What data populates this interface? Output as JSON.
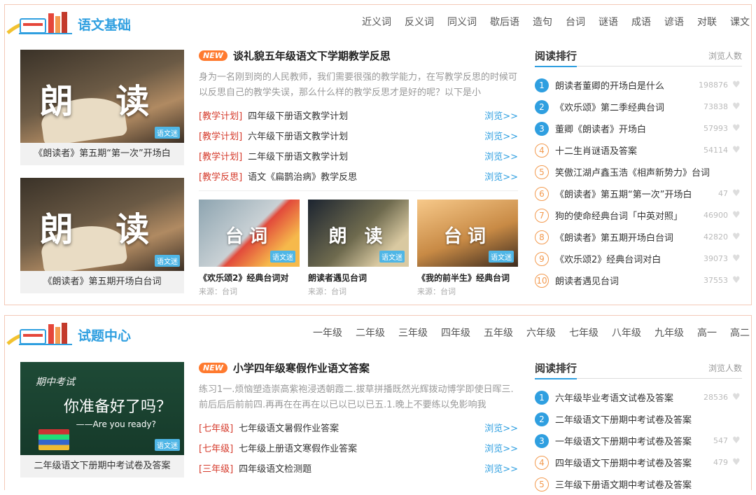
{
  "colors": {
    "accent": "#2f9fe0",
    "category": "#d53a2b",
    "badge": "#ff7a2f",
    "rank_low": "#f39a4f",
    "border": "#f3c9b8"
  },
  "sections": [
    {
      "title": "语文基础",
      "nav": [
        "近义词",
        "反义词",
        "同义词",
        "歇后语",
        "造句",
        "台词",
        "谜语",
        "成语",
        "谚语",
        "对联",
        "课文"
      ],
      "thumbs": [
        {
          "overlay": "朗 读",
          "watermark": "语文迷",
          "caption": "《朗读者》第五期“第一次”开场白"
        },
        {
          "overlay": "朗 读",
          "watermark": "语文迷",
          "caption": "《朗读者》第五期开场白台词"
        }
      ],
      "badge": "NEW",
      "headline": "谈礼貌五年级语文下学期教学反思",
      "summary": "身为一名刚到岗的人民教师，我们需要很强的教学能力，在写教学反思的时候可以反思自己的教学失误，那么什么样的教学反思才是好的呢？以下是小",
      "articles": [
        {
          "cat": "[教学计划]",
          "title": "四年级下册语文教学计划",
          "more": "浏览>>"
        },
        {
          "cat": "[教学计划]",
          "title": "六年级下册语文教学计划",
          "more": "浏览>>"
        },
        {
          "cat": "[教学计划]",
          "title": "二年级下册语文教学计划",
          "more": "浏览>>"
        },
        {
          "cat": "[教学反思]",
          "title": "语文《扁鹊治病》教学反思",
          "more": "浏览>>"
        }
      ],
      "cards": [
        {
          "overlay": "台词",
          "title": "《欢乐颂2》经典台词对",
          "source": "来源：台词"
        },
        {
          "overlay": "朗 读",
          "title": "朗读者遇见台词",
          "source": "来源：台词"
        },
        {
          "overlay": "台词",
          "title": "《我的前半生》经典台词",
          "source": "来源：台词"
        }
      ],
      "rank_title": "阅读排行",
      "rank_sub": "浏览人数",
      "ranks": [
        {
          "n": "1",
          "title": "朗读者董卿的开场白是什么",
          "count": "198876"
        },
        {
          "n": "2",
          "title": "《欢乐颂》第二季经典台词",
          "count": "73838"
        },
        {
          "n": "3",
          "title": "董卿《朗读者》开场白",
          "count": "57993"
        },
        {
          "n": "4",
          "title": "十二生肖谜语及答案",
          "count": "54114"
        },
        {
          "n": "5",
          "title": "笑傲江湖卢鑫玉浩《相声新势力》台词",
          "count": ""
        },
        {
          "n": "6",
          "title": "《朗读者》第五期“第一次”开场白",
          "count": "47"
        },
        {
          "n": "7",
          "title": "狗的使命经典台词「中英对照」",
          "count": "46900"
        },
        {
          "n": "8",
          "title": "《朗读者》第五期开场白台词",
          "count": "42820"
        },
        {
          "n": "9",
          "title": "《欢乐颂2》经典台词对白",
          "count": "39073"
        },
        {
          "n": "10",
          "title": "朗读者遇见台词",
          "count": "37553"
        }
      ]
    },
    {
      "title": "试题中心",
      "nav": [
        "一年级",
        "二年级",
        "三年级",
        "四年级",
        "五年级",
        "六年级",
        "七年级",
        "八年级",
        "九年级",
        "高一",
        "高二"
      ],
      "thumbs": [
        {
          "exam_line1": "期中考试",
          "exam_line2": "你准备好了吗？",
          "exam_line3": "——Are you ready?",
          "watermark": "语文迷",
          "caption": "二年级语文下册期中考试卷及答案"
        }
      ],
      "badge": "NEW",
      "headline": "小学四年级寒假作业语文答案",
      "summary": "练习1一.烦恼塑造崇高紫袍浸透朝霞二.拔草拼播既然光辉拨动博学即使日晖三.前后后后前前四.再再在在再在以已以已以已五.1.晚上不要练以免影响我",
      "articles": [
        {
          "cat": "[七年级]",
          "title": "七年级语文暑假作业答案",
          "more": "浏览>>"
        },
        {
          "cat": "[七年级]",
          "title": "七年级上册语文寒假作业答案",
          "more": "浏览>>"
        },
        {
          "cat": "[三年级]",
          "title": "四年级语文检测题",
          "more": "浏览>>"
        }
      ],
      "rank_title": "阅读排行",
      "rank_sub": "浏览人数",
      "ranks": [
        {
          "n": "1",
          "title": "六年级毕业考语文试卷及答案",
          "count": "28536"
        },
        {
          "n": "2",
          "title": "二年级语文下册期中考试卷及答案",
          "count": ""
        },
        {
          "n": "3",
          "title": "一年级语文下册期中考试卷及答案",
          "count": "547"
        },
        {
          "n": "4",
          "title": "四年级语文下册期中考试卷及答案",
          "count": "479"
        },
        {
          "n": "5",
          "title": "三年级下册语文期中考试卷及答案",
          "count": ""
        }
      ]
    }
  ]
}
